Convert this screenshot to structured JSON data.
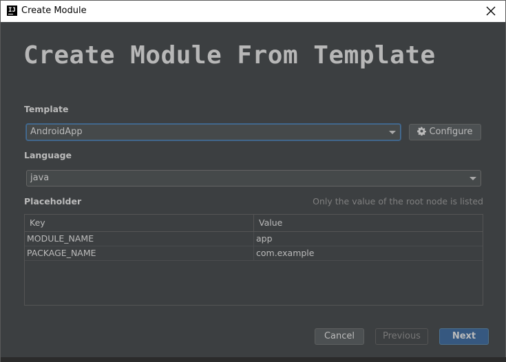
{
  "window": {
    "title": "Create Module",
    "app_icon_glyph": "IJ"
  },
  "heading": "Create Module From Template",
  "template": {
    "label": "Template",
    "selected": "AndroidApp",
    "configure_label": "Configure"
  },
  "language": {
    "label": "Language",
    "selected": "java"
  },
  "placeholder": {
    "label": "Placeholder",
    "hint": "Only the value of the root node is listed",
    "columns": [
      "Key",
      "Value"
    ],
    "rows": [
      [
        "MODULE_NAME",
        "app"
      ],
      [
        "PACKAGE_NAME",
        "com.example"
      ]
    ]
  },
  "footer": {
    "cancel_label": "Cancel",
    "previous_label": "Previous",
    "next_label": "Next"
  },
  "colors": {
    "background": "#3c3f41",
    "primary_button": "#365880",
    "focus_border": "#466d94"
  }
}
